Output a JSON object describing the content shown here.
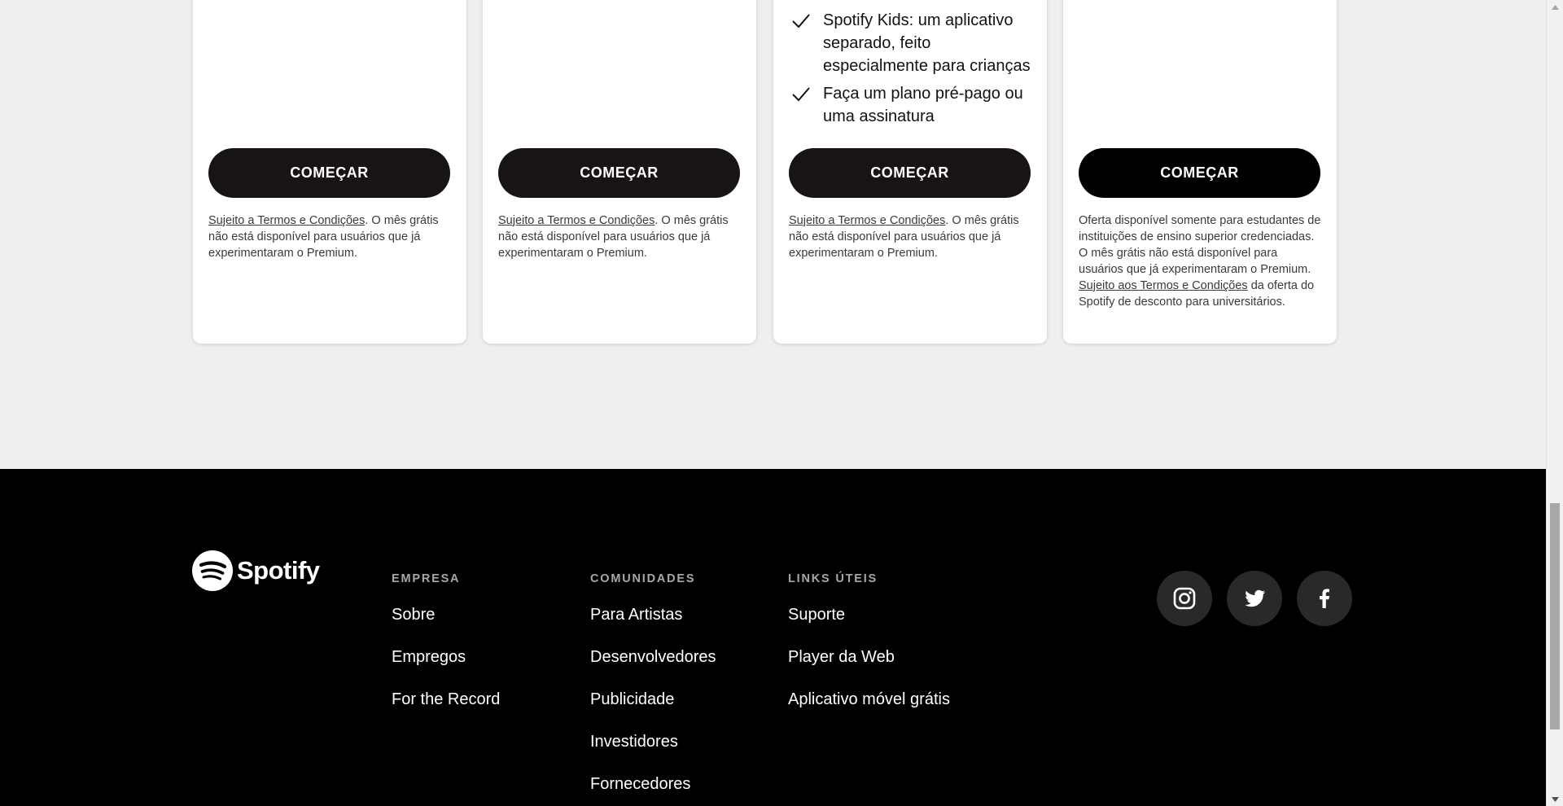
{
  "plans": [
    {
      "features": [],
      "cta_label": "COMEÇAR",
      "terms_link": "Sujeito a Termos e Condições",
      "fine_print": ". O mês grátis não está disponível para usuários que já experimentaram o Premium."
    },
    {
      "features": [],
      "cta_label": "COMEÇAR",
      "terms_link": "Sujeito a Termos e Condições",
      "fine_print": ". O mês grátis não está disponível para usuários que já experimentaram o Premium."
    },
    {
      "features": [
        "Spotify Kids: um aplicativo separado, feito especialmente para crianças",
        "Faça um plano pré-pago ou uma assinatura"
      ],
      "cta_label": "COMEÇAR",
      "terms_link": "Sujeito a Termos e Condições",
      "fine_print": ". O mês grátis não está disponível para usuários que já experimentaram o Premium."
    },
    {
      "features": [],
      "cta_label": "COMEÇAR",
      "fine_print_intro": "Oferta disponível somente para estudantes de instituições de ensino superior credenciadas. O mês grátis não está disponível para usuários que já experimentaram o Premium. ",
      "terms_link": "Sujeito aos Termos e Condições",
      "fine_print_outro": " da oferta do Spotify de desconto para universitários."
    }
  ],
  "footer": {
    "logo_text": "Spotify",
    "columns": [
      {
        "heading": "EMPRESA",
        "links": [
          "Sobre",
          "Empregos",
          "For the Record"
        ]
      },
      {
        "heading": "COMUNIDADES",
        "links": [
          "Para Artistas",
          "Desenvolvedores",
          "Publicidade",
          "Investidores",
          "Fornecedores"
        ]
      },
      {
        "heading": "LINKS ÚTEIS",
        "links": [
          "Suporte",
          "Player da Web",
          "Aplicativo móvel grátis"
        ]
      }
    ],
    "socials": [
      "instagram-icon",
      "twitter-icon",
      "facebook-icon"
    ]
  },
  "colors": {
    "page_bg": "#efefef",
    "button_bg": "#191414",
    "footer_bg": "#000000",
    "social_bg": "#292929",
    "heading_gray": "#a7a7a7"
  }
}
